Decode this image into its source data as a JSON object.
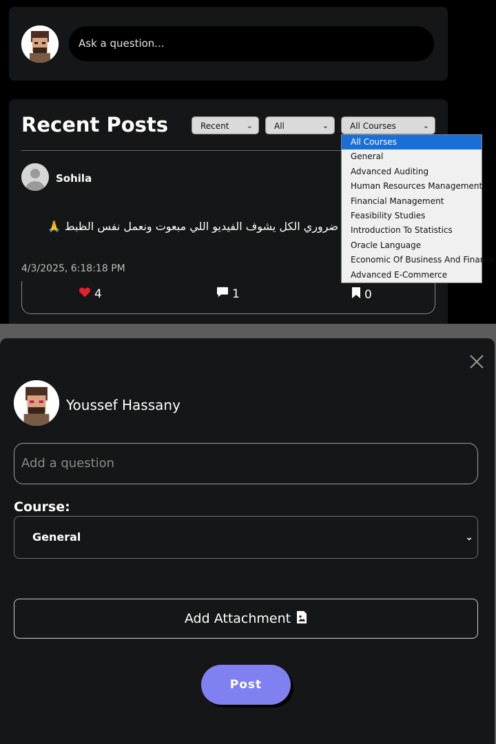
{
  "ask": {
    "placeholder": "Ask a question..."
  },
  "posts": {
    "title": "Recent Posts",
    "filters": {
      "sort": "Recent",
      "type": "All",
      "course": "All Courses"
    },
    "post": {
      "author": "Sohila",
      "body": "نك استمارات التخرج ضروري الكل يشوف الفيديو اللي مبعوت ونعمل نفس الظبط 🙏",
      "timestamp": "4/3/2025, 6:18:18 PM",
      "likes": "4",
      "comments": "1",
      "saves": "0"
    }
  },
  "course_dropdown": {
    "options": [
      "All Courses",
      "General",
      "Advanced Auditing",
      "Human Resources Management",
      "Financial Management",
      "Feasibility Studies",
      "Introduction To Statistics",
      "Oracle Language",
      "Economic Of Business And Finance",
      "Advanced E-Commerce"
    ],
    "selected_index": 0
  },
  "modal": {
    "user_name": "Youssef Hassany",
    "question_placeholder": "Add a question",
    "course_label": "Course:",
    "course_value": "General",
    "attachment_label": "Add Attachment",
    "post_label": "Post"
  },
  "colors": {
    "accent": "#8080f0",
    "like": "#e8202a",
    "highlight": "#1a6fd6"
  }
}
